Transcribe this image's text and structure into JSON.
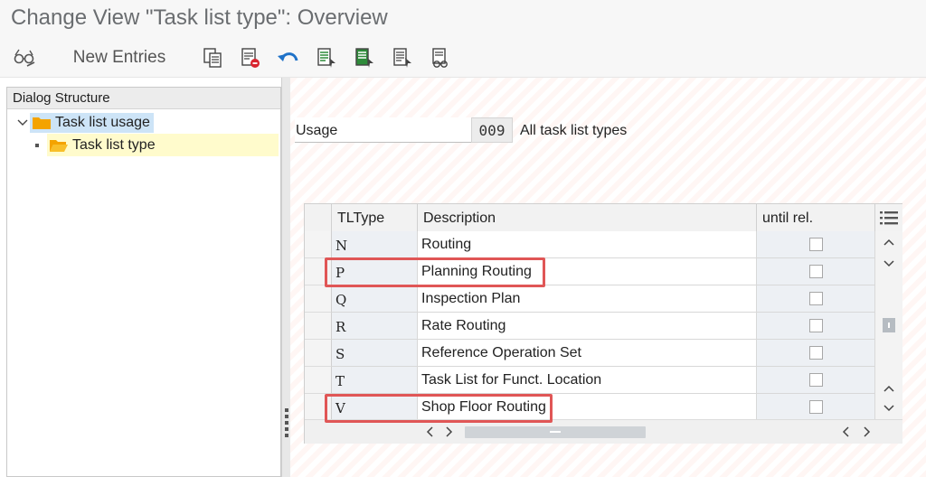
{
  "window": {
    "title": "Change View \"Task list type\": Overview"
  },
  "toolbar": {
    "new_entries_label": "New Entries",
    "icons": [
      "glasses-edit-icon",
      "copy-icon",
      "delete-icon",
      "undo-icon",
      "select-all-icon",
      "select-block-icon",
      "deselect-icon",
      "print-view-icon"
    ]
  },
  "dialog_structure": {
    "header": "Dialog Structure",
    "items": [
      {
        "label": "Task list usage",
        "level": 0,
        "expanded": true,
        "selected": true
      },
      {
        "label": "Task list type",
        "level": 1,
        "expanded": false,
        "selected": false
      }
    ]
  },
  "usage": {
    "label": "Usage",
    "code": "009",
    "description": "All task list types"
  },
  "table": {
    "columns": [
      "TLType",
      "Description",
      "until rel."
    ],
    "rows": [
      {
        "type": "N",
        "description": "Routing",
        "until_rel": false
      },
      {
        "type": "P",
        "description": "Planning Routing",
        "until_rel": false
      },
      {
        "type": "Q",
        "description": "Inspection Plan",
        "until_rel": false
      },
      {
        "type": "R",
        "description": "Rate Routing",
        "until_rel": false
      },
      {
        "type": "S",
        "description": "Reference Operation Set",
        "until_rel": false
      },
      {
        "type": "T",
        "description": "Task List for Funct. Location",
        "until_rel": false
      },
      {
        "type": "V",
        "description": "Shop Floor Routing",
        "until_rel": false
      }
    ],
    "highlighted_rows": [
      "P",
      "V"
    ]
  },
  "colors": {
    "highlight": "#e05656",
    "folder": "#f4a300",
    "selection": "#cde4f7",
    "active_row": "#fffbcc"
  }
}
